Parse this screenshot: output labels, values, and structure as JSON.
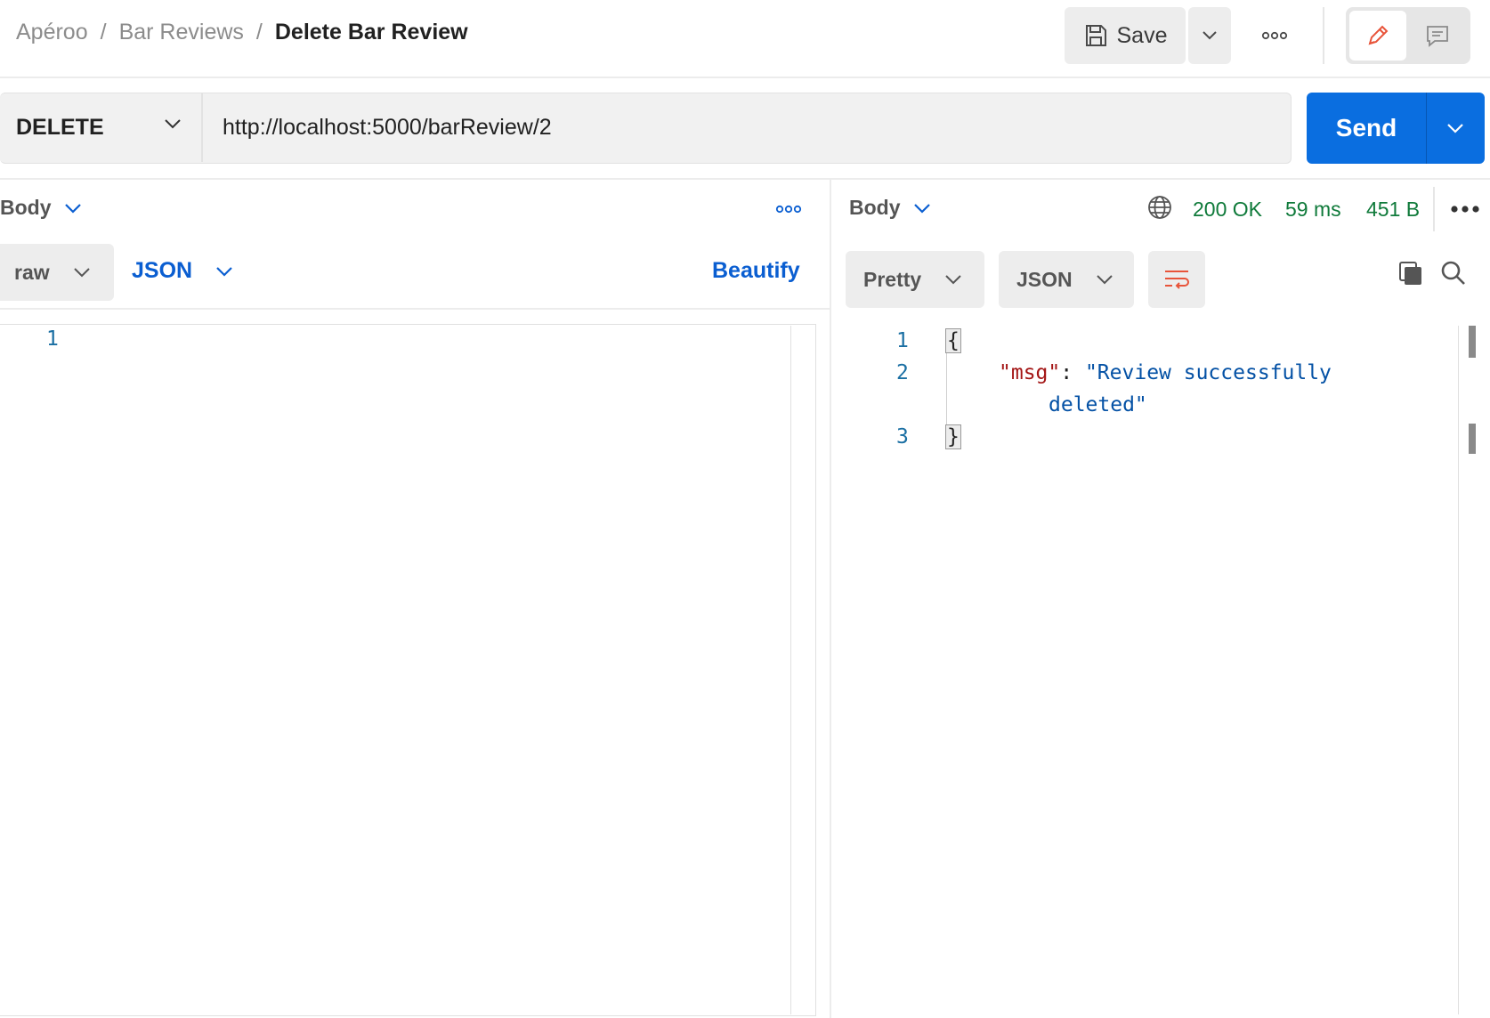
{
  "breadcrumb": {
    "items": [
      "Apéroo",
      "Bar Reviews"
    ],
    "separator": "/",
    "current": "Delete Bar Review"
  },
  "toolbar": {
    "save_label": "Save",
    "save_icon": "save-icon",
    "more_icon": "more-horizontal-icon",
    "edit_icon": "pencil-icon",
    "comment_icon": "comment-icon"
  },
  "request": {
    "method": "DELETE",
    "url": "http://localhost:5000/barReview/2",
    "send_label": "Send"
  },
  "request_pane": {
    "body_label": "Body",
    "body_type": "raw",
    "format": "JSON",
    "beautify_label": "Beautify",
    "line_numbers": [
      "1"
    ]
  },
  "response_pane": {
    "body_label": "Body",
    "status": "200 OK",
    "time": "59 ms",
    "size": "451 B",
    "view_mode": "Pretty",
    "format": "JSON",
    "lines": [
      {
        "num": "1",
        "open": "{"
      },
      {
        "num": "2",
        "key": "\"msg\"",
        "colon": ": ",
        "value_part1": "\"Review successfully",
        "value_part2": "deleted\""
      },
      {
        "num": "3",
        "close": "}"
      }
    ]
  },
  "colors": {
    "accent": "#0a6ee0",
    "link": "#0a5ed1",
    "status_ok": "#0f7a3a",
    "json_key": "#a31515",
    "json_string": "#0451a5",
    "edit_icon": "#e8543a"
  }
}
